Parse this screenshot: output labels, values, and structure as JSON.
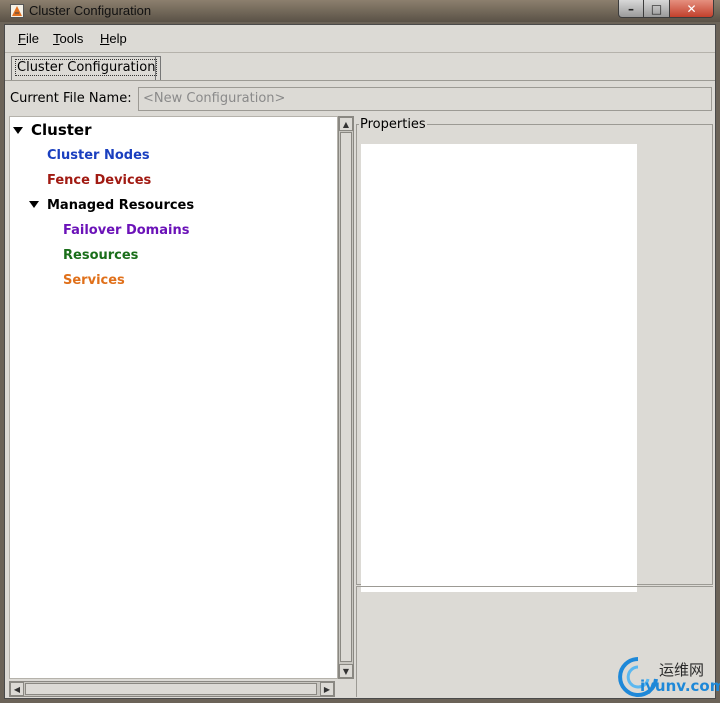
{
  "window": {
    "title": "Cluster Configuration",
    "minimize_glyph": "–",
    "maximize_glyph": "□",
    "close_glyph": "✕"
  },
  "menu": {
    "file": {
      "accel": "F",
      "rest": "ile"
    },
    "tools": {
      "accel": "T",
      "rest": "ools"
    },
    "help": {
      "accel": "H",
      "rest": "elp"
    }
  },
  "tab": {
    "label": "Cluster Configuration"
  },
  "file_name": {
    "label": "Current File Name:",
    "value": "<New Configuration>"
  },
  "tree": {
    "root": {
      "label": "Cluster",
      "color": "#000000",
      "expanded": true
    },
    "items": [
      {
        "label": "Cluster Nodes",
        "color": "#1a3fbf"
      },
      {
        "label": "Fence Devices",
        "color": "#a11a12"
      },
      {
        "label": "Managed Resources",
        "color": "#000000",
        "expanded": true
      },
      {
        "label": "Failover Domains",
        "color": "#6b12b8"
      },
      {
        "label": "Resources",
        "color": "#1a6e1a"
      },
      {
        "label": "Services",
        "color": "#e0701a"
      }
    ]
  },
  "properties": {
    "label": "Properties"
  },
  "watermark": {
    "chinese": "运维网",
    "site": "iyunv.com"
  }
}
